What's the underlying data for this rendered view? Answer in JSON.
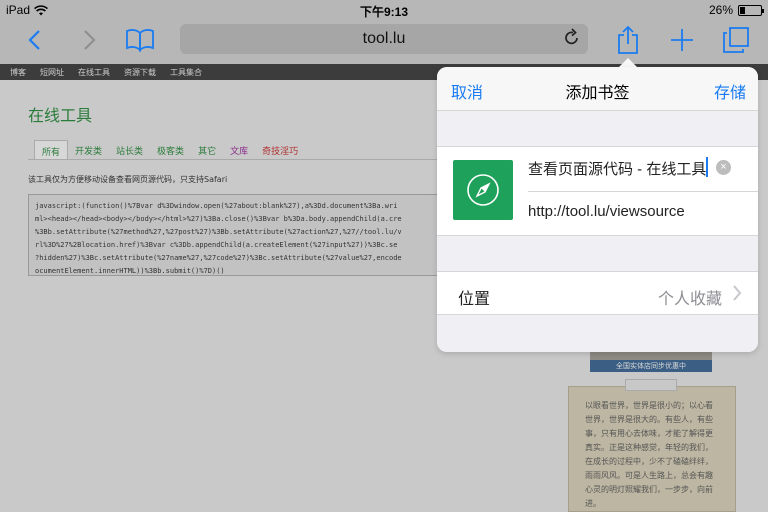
{
  "status_bar": {
    "device": "iPad",
    "time": "下午9:13",
    "battery_text": "26%",
    "battery_level": 0.26
  },
  "safari": {
    "url_display": "tool.lu",
    "icons": [
      "back-icon",
      "forward-icon",
      "bookmarks-icon",
      "reload-icon",
      "share-icon",
      "new-tab-icon",
      "tabs-icon"
    ],
    "accent_color": "#1a7cf0"
  },
  "site_nav": [
    "博客",
    "短网址",
    "在线工具",
    "资源下载",
    "工具集合"
  ],
  "page": {
    "title": "在线工具",
    "tabs": [
      "所有",
      "开发类",
      "站长类",
      "极客类",
      "其它",
      "文库",
      "奇技淫巧"
    ],
    "active_tab": "所有",
    "note": "该工具仅为方便移动设备查看网页源代码，只支持Safari",
    "code_lines": [
      "javascript:(function()%7Bvar d%3Dwindow.open(%27about:blank%27),a%3Dd.document%3Ba.wri",
      "ml><head></head><body></body></html>%27)%3Ba.close()%3Bvar b%3Da.body.appendChild(a.cre",
      "%3Bb.setAttribute(%27method%27,%27post%27)%3Bb.setAttribute(%27action%27,%27//tool.lu/v",
      "rl%3D%27%2Blocation.href)%3Bvar c%3Db.appendChild(a.createElement(%27input%27))%3Bc.se",
      "?hidden%27)%3Bc.setAttribute(%27name%27,%27code%27)%3Bc.setAttribute(%27value%27,encode",
      "ocumentElement.innerHTML))%3Bb.submit()%7D)()"
    ],
    "ad_caption": "全国实体店同步优惠中",
    "quote_text": "以眼看世界，世界是很小的；以心看世界，世界是很大的。有些人，有些事，只有用心去体味，才能了解得更真实。正是这种感觉，年轻的我们，在成长的过程中，少不了磕磕绊绊，雨雨风风。可是人生路上，总会有趣心灵的明灯照耀我们，一步步，向前进。"
  },
  "popover": {
    "cancel_label": "取消",
    "title": "添加书签",
    "save_label": "存储",
    "bookmark_title": "查看页面源代码 - 在线工具",
    "bookmark_url": "http://tool.lu/viewsource",
    "location_label": "位置",
    "location_value": "个人收藏"
  }
}
